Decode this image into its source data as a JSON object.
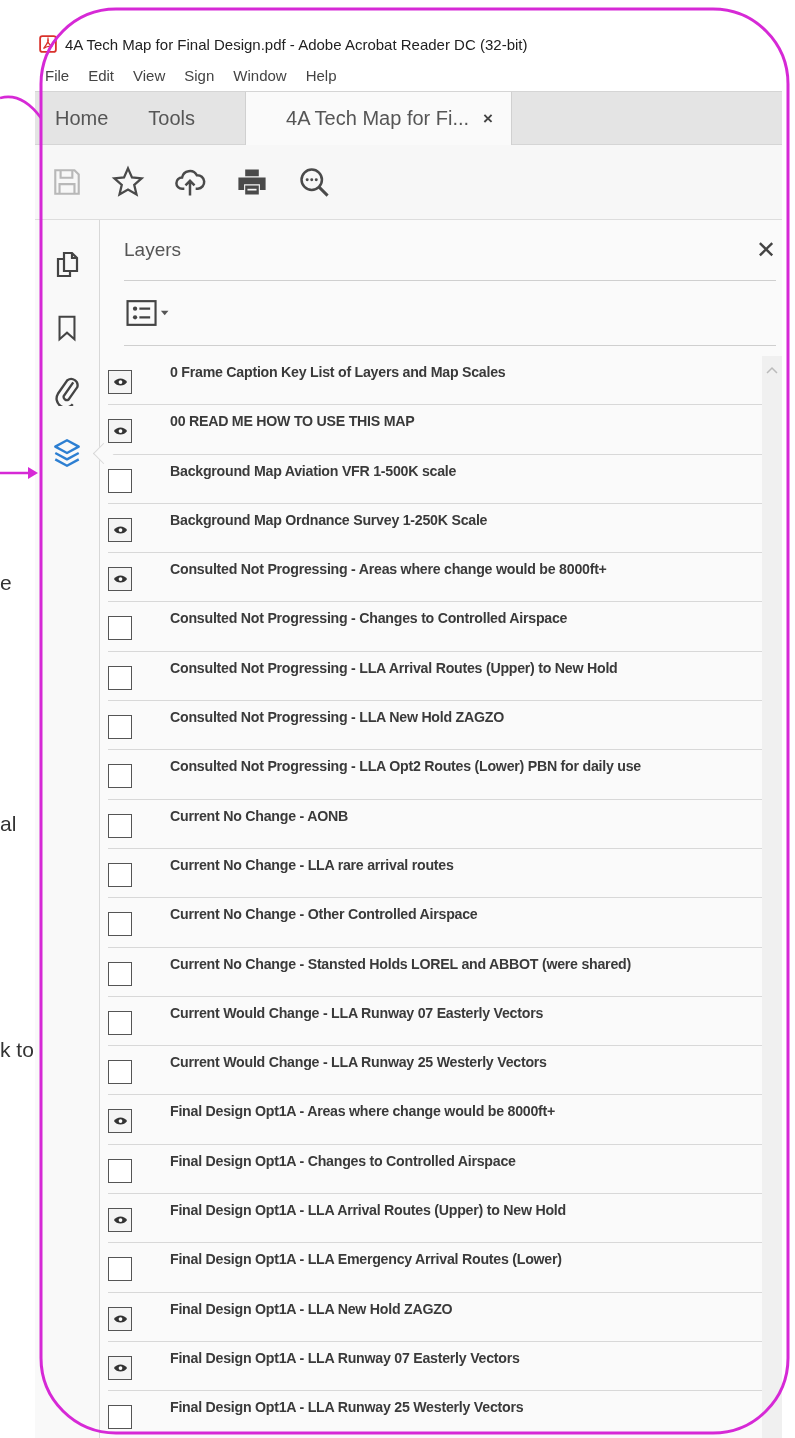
{
  "background_fragments": [
    "e",
    "al",
    "k to"
  ],
  "window": {
    "title": "4A Tech Map for Final Design.pdf - Adobe Acrobat Reader DC (32-bit)"
  },
  "menu": [
    "File",
    "Edit",
    "View",
    "Sign",
    "Window",
    "Help"
  ],
  "tabs": [
    {
      "label": "Home",
      "selected": false
    },
    {
      "label": "Tools",
      "selected": false
    },
    {
      "label": "4A Tech Map for Fi...",
      "selected": true,
      "close": "×"
    }
  ],
  "toolbar": [
    {
      "disabled": true
    },
    {
      "disabled": false
    },
    {
      "disabled": false
    },
    {
      "disabled": false
    },
    {
      "disabled": false
    }
  ],
  "side_rail": [
    {
      "selected": false
    },
    {
      "selected": false
    },
    {
      "selected": false
    },
    {
      "selected": true
    }
  ],
  "layers_panel": {
    "title": "Layers",
    "close": "✕",
    "layers": [
      {
        "name": "0 Frame Caption Key List of Layers and Map Scales",
        "visible": true
      },
      {
        "name": "00 READ ME HOW TO USE THIS MAP",
        "visible": true
      },
      {
        "name": "Background Map Aviation VFR 1-500K scale",
        "visible": false
      },
      {
        "name": "Background Map Ordnance Survey 1-250K Scale",
        "visible": true
      },
      {
        "name": "Consulted Not Progressing - Areas where change would be 8000ft+",
        "visible": true
      },
      {
        "name": "Consulted Not Progressing - Changes to Controlled Airspace",
        "visible": false
      },
      {
        "name": "Consulted Not Progressing - LLA Arrival Routes (Upper) to New Hold",
        "visible": false
      },
      {
        "name": "Consulted Not Progressing - LLA New Hold ZAGZO",
        "visible": false
      },
      {
        "name": "Consulted Not Progressing - LLA Opt2 Routes (Lower) PBN for daily use",
        "visible": false
      },
      {
        "name": "Current No Change - AONB",
        "visible": false
      },
      {
        "name": "Current No Change - LLA rare arrival routes",
        "visible": false
      },
      {
        "name": "Current No Change - Other Controlled Airspace",
        "visible": false
      },
      {
        "name": "Current No Change - Stansted Holds LOREL and ABBOT (were shared)",
        "visible": false
      },
      {
        "name": "Current Would Change - LLA Runway 07 Easterly Vectors",
        "visible": false
      },
      {
        "name": "Current Would Change - LLA Runway 25 Westerly Vectors",
        "visible": false
      },
      {
        "name": "Final Design Opt1A - Areas where change would be 8000ft+",
        "visible": true
      },
      {
        "name": "Final Design Opt1A - Changes to Controlled Airspace",
        "visible": false
      },
      {
        "name": "Final Design Opt1A - LLA Arrival Routes (Upper) to New Hold",
        "visible": true
      },
      {
        "name": "Final Design Opt1A - LLA Emergency Arrival Routes (Lower)",
        "visible": false
      },
      {
        "name": "Final Design Opt1A - LLA New Hold ZAGZO",
        "visible": true
      },
      {
        "name": "Final Design Opt1A - LLA Runway 07 Easterly Vectors",
        "visible": true
      },
      {
        "name": "Final Design Opt1A - LLA Runway 25 Westerly Vectors",
        "visible": false
      }
    ]
  }
}
